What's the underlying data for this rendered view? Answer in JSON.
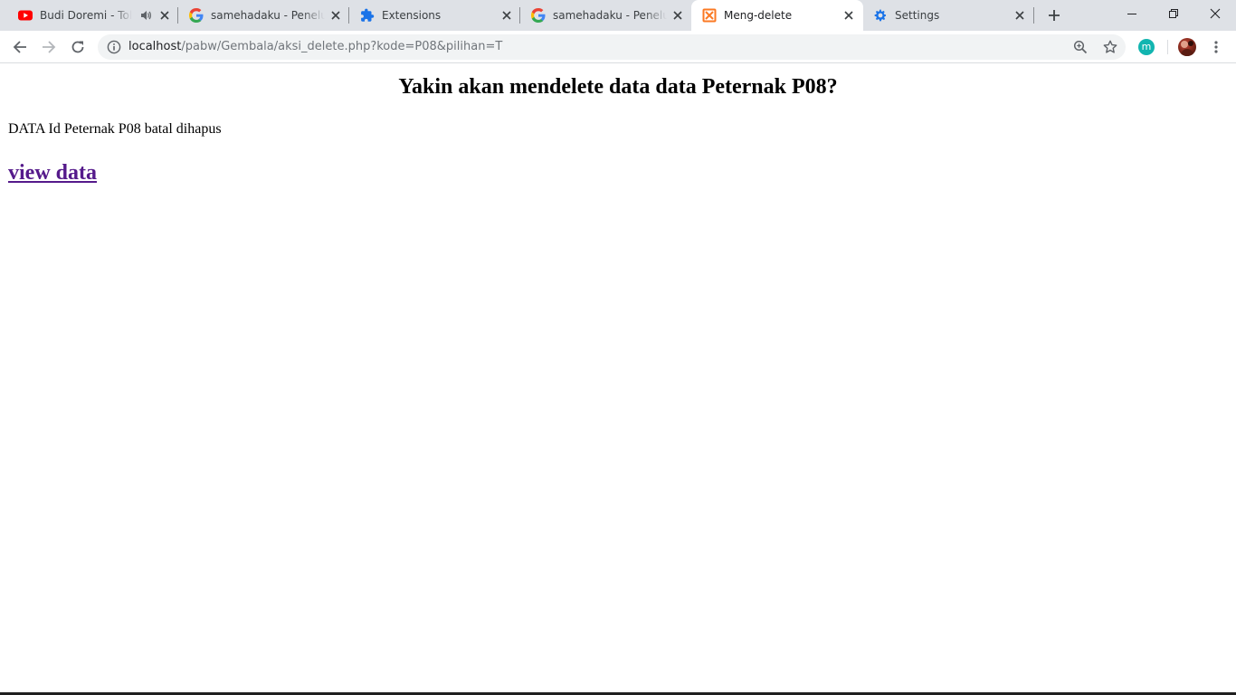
{
  "tabs": [
    {
      "title": "Budi Doremi - Tolong",
      "icon": "youtube-icon",
      "audio": true,
      "active": false
    },
    {
      "title": "samehadaku - Penelusuran",
      "icon": "google-icon",
      "active": false
    },
    {
      "title": "Extensions",
      "icon": "puzzle-icon",
      "active": false
    },
    {
      "title": "samehadaku - Penelusuran",
      "icon": "google-icon",
      "active": false
    },
    {
      "title": "Meng-delete",
      "icon": "xampp-icon",
      "active": true
    },
    {
      "title": "Settings",
      "icon": "gear-icon",
      "active": false
    }
  ],
  "address_bar": {
    "host": "localhost",
    "path": "/pabw/Gembala/aksi_delete.php?kode=P08&pilihan=T"
  },
  "extension_badge": "m",
  "page": {
    "heading": "Yakin akan mendelete data data Peternak P08?",
    "message": "DATA Id Peternak P08 batal dihapus",
    "link_text": "view data"
  },
  "colors": {
    "tabstrip_bg": "#dee1e6",
    "omnibox_bg": "#f1f3f4",
    "visited_link": "#551a8b",
    "youtube_red": "#ff0000",
    "xampp_orange": "#fb7a24",
    "chrome_blue": "#1a73e8"
  }
}
